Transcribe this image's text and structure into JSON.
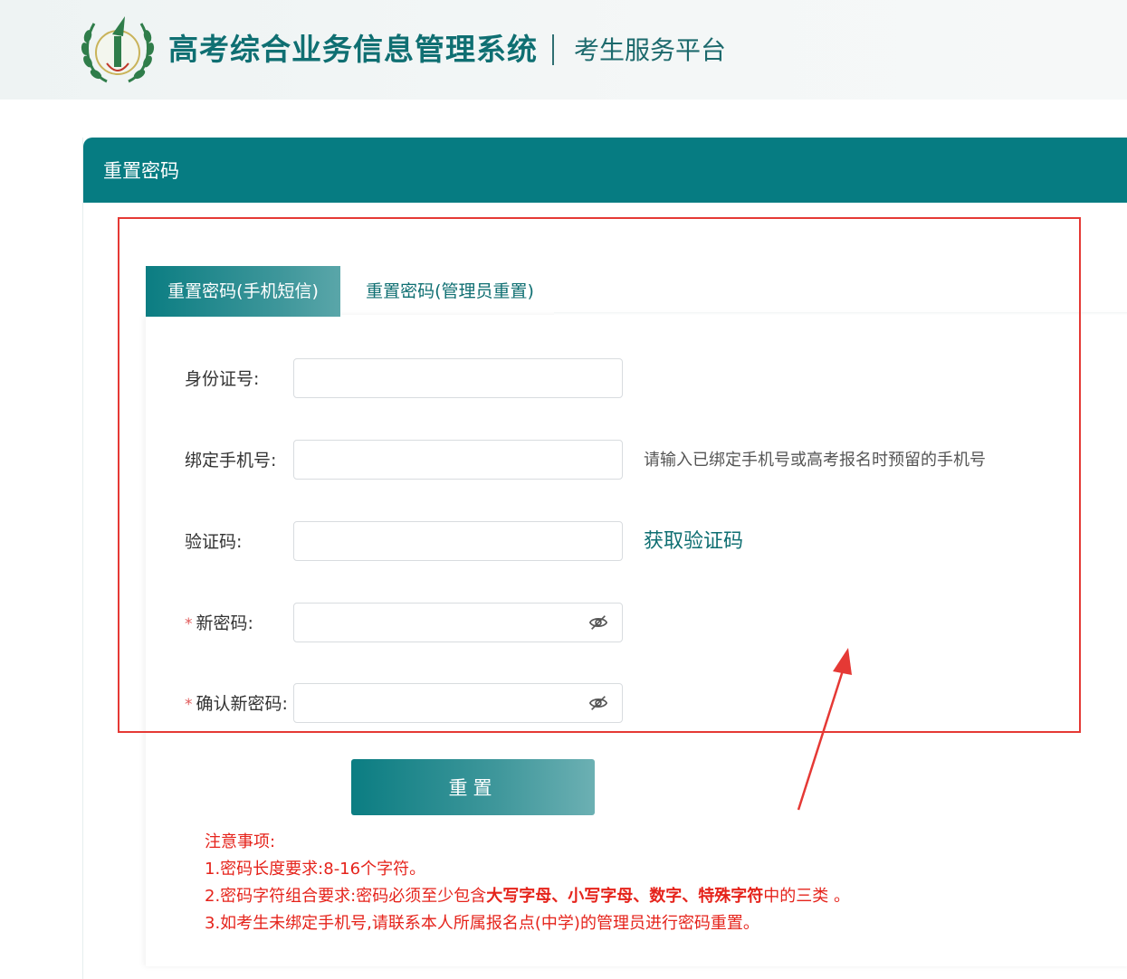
{
  "header": {
    "system_title": "高考综合业务信息管理系统",
    "platform_title": "考生服务平台"
  },
  "panel": {
    "title": "重置密码"
  },
  "tabs": [
    {
      "label": "重置密码(手机短信)",
      "active": true
    },
    {
      "label": "重置密码(管理员重置)",
      "active": false
    }
  ],
  "form": {
    "id_label": "身份证号:",
    "id_value": "",
    "phone_label": "绑定手机号:",
    "phone_value": "",
    "phone_hint": "请输入已绑定手机号或高考报名时预留的手机号",
    "code_label": "验证码:",
    "code_value": "",
    "get_code_label": "获取验证码",
    "required_mark": "*",
    "new_pwd_label": "新密码:",
    "new_pwd_value": "",
    "confirm_pwd_label": "确认新密码:",
    "confirm_pwd_value": "",
    "reset_label": "重置"
  },
  "notes": {
    "title": "注意事项:",
    "item1": "1.密码长度要求:8-16个字符。",
    "item2_prefix": "2.密码字符组合要求:密码必须至少包含",
    "item2_bold": "大写字母、小写字母、数字、特殊字符",
    "item2_suffix": "中的三类 。",
    "item3": "3.如考生未绑定手机号,请联系本人所属报名点(中学)的管理员进行密码重置。"
  },
  "colors": {
    "brand": "#067c82",
    "annotation": "#e53935",
    "warning_text": "#e5231b"
  },
  "icons": [
    "logo-emblem",
    "eye-off-icon",
    "eye-off-icon"
  ]
}
